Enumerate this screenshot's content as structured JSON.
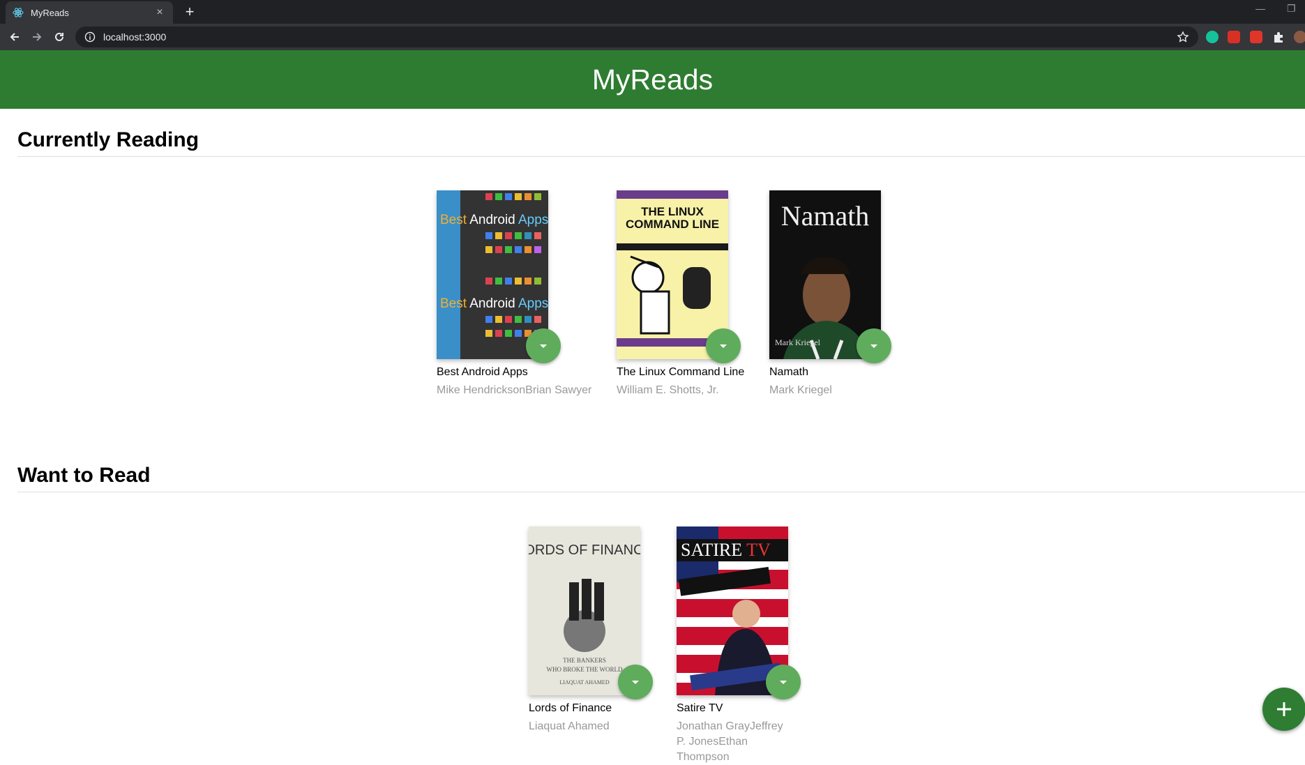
{
  "browser": {
    "tab_title": "MyReads",
    "tab_close": "×",
    "new_tab": "+",
    "url": "localhost:3000",
    "minimize": "—",
    "restore": "❐"
  },
  "app": {
    "title": "MyReads"
  },
  "shelves": [
    {
      "title": "Currently Reading",
      "books": [
        {
          "title": "Best Android Apps",
          "authors": "Mike HendricksonBrian Sawyer",
          "cover_text": "Best Android Apps"
        },
        {
          "title": "The Linux Command Line",
          "authors": "William E. Shotts, Jr.",
          "cover_text": "THE LINUX COMMAND LINE"
        },
        {
          "title": "Namath",
          "authors": "Mark Kriegel",
          "cover_text": "Namath"
        }
      ]
    },
    {
      "title": "Want to Read",
      "books": [
        {
          "title": "Lords of Finance",
          "authors": "Liaquat Ahamed",
          "cover_text": "LORDS OF FINANCE"
        },
        {
          "title": "Satire TV",
          "authors": "Jonathan GrayJeffrey P. JonesEthan Thompson",
          "cover_text": "SATIRE TV"
        }
      ]
    }
  ],
  "colors": {
    "header": "#2e7c31",
    "shelf_changer": "#60ac5d",
    "fab": "#2e7d32"
  },
  "icons": {
    "shelf_changer": "arrow-drop-down-icon",
    "fab": "add-icon"
  }
}
